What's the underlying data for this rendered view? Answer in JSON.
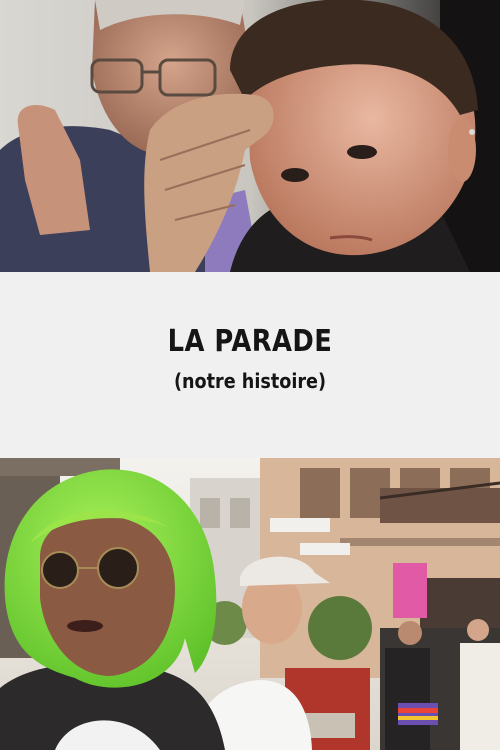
{
  "poster": {
    "title": "LA PARADE",
    "subtitle": "(notre histoire)"
  },
  "colors": {
    "panel_background": "#f0f0f0",
    "title_text": "#151515",
    "wig_green": "#86e23a"
  },
  "images": {
    "top": "photo-two-men-close-up",
    "bottom": "photo-parade-street-green-wig"
  }
}
